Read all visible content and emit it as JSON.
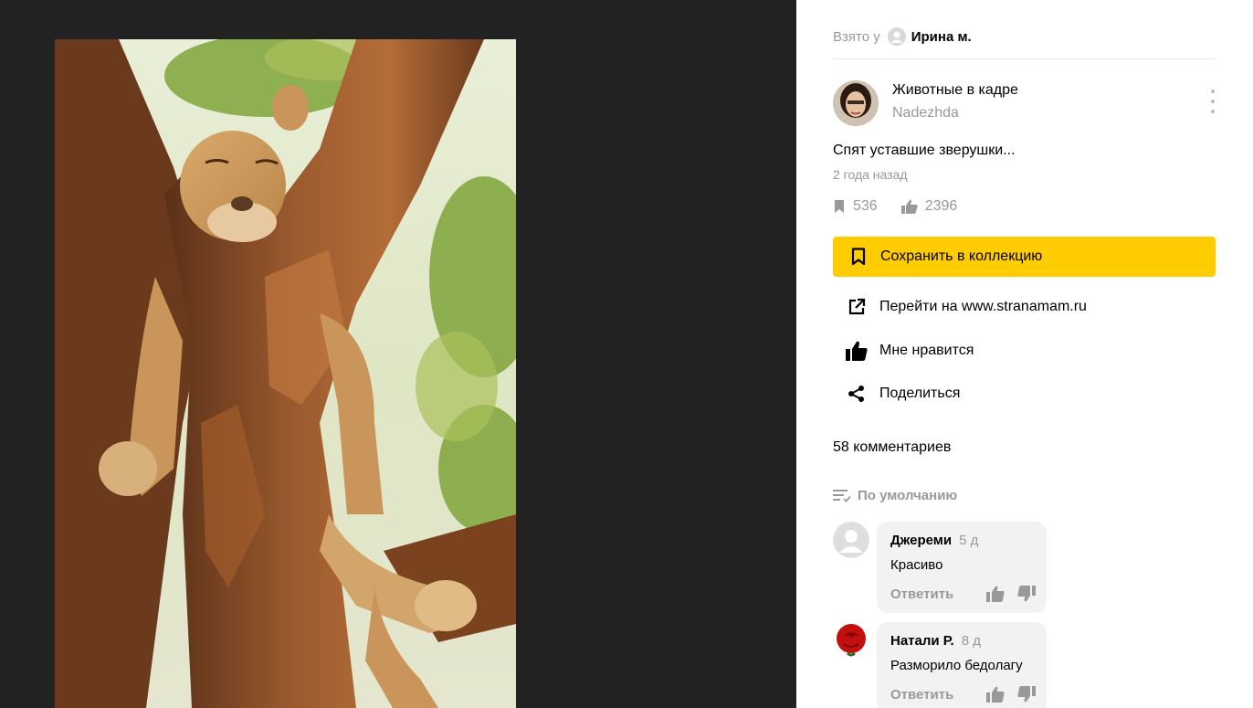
{
  "header": {
    "taken_from_label": "Взято у",
    "taken_from_user": "Ирина м."
  },
  "collection": {
    "title": "Животные в кадре",
    "author": "Nadezhda"
  },
  "card": {
    "description": "Спят уставшие зверушки...",
    "time_ago": "2 года назад",
    "saves_count": "536",
    "likes_count": "2396"
  },
  "actions": {
    "save_label": "Сохранить в коллекцию",
    "goto_label": "Перейти на www.stranamam.ru",
    "like_label": "Мне нравится",
    "share_label": "Поделиться"
  },
  "comments": {
    "count_label": "58 комментариев",
    "sort_label": "По умолчанию",
    "reply_label": "Ответить",
    "items": [
      {
        "author": "Джереми",
        "age": "5 д",
        "text": "Красиво"
      },
      {
        "author": "Натали Р.",
        "age": "8 д",
        "text": "Разморило бедолагу"
      }
    ]
  },
  "colors": {
    "viewer_bg": "#222222",
    "accent_yellow": "#ffcc00",
    "muted_text": "#999999",
    "comment_bg": "#f2f2f2"
  },
  "icons": {
    "bookmark": "bookmark-icon",
    "like": "thumb-up-icon",
    "dislike": "thumb-down-icon",
    "external": "external-link-icon",
    "share": "share-icon",
    "sort": "sort-icon",
    "more": "more-vertical-icon"
  }
}
